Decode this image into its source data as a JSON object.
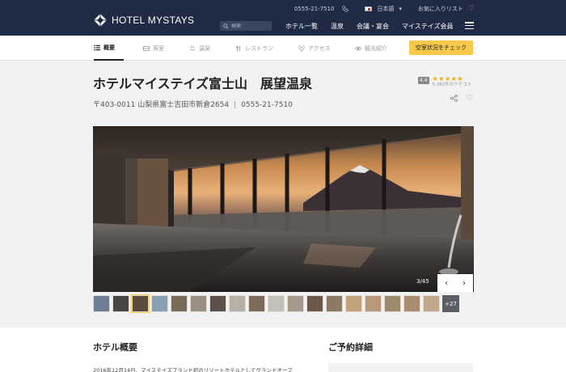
{
  "header": {
    "logo_text": "HOTEL MYSTAYS",
    "phone": "0555-21-7510",
    "language": "日本語",
    "favorites": "お気に入りリスト",
    "search_placeholder": "検索",
    "nav": [
      "ホテル一覧",
      "温泉",
      "会議・宴会",
      "マイステイズ会員"
    ]
  },
  "subnav": {
    "tabs": [
      {
        "label": "概要",
        "icon": "list-icon"
      },
      {
        "label": "客室",
        "icon": "bed-icon"
      },
      {
        "label": "温泉",
        "icon": "hot-spring-icon"
      },
      {
        "label": "レストラン",
        "icon": "restaurant-icon"
      },
      {
        "label": "アクセス",
        "icon": "map-pin-icon"
      },
      {
        "label": "観光紹介",
        "icon": "eye-icon"
      }
    ],
    "cta": "空室状況をチェック"
  },
  "hotel": {
    "title": "ホテルマイステイズ富士山　展望温泉",
    "postal_address": "〒403-0011 山梨県富士吉田市新倉2654",
    "phone": "0555-21-7510",
    "rating_score": "4.4",
    "stars": "★★★★★",
    "reviews": "5,382件のクチコミ"
  },
  "gallery": {
    "counter": "3/45",
    "prev": "‹",
    "next": "›",
    "more": "+27",
    "thumb_colors": [
      "#6f7f93",
      "#4a4540",
      "#5c4a3a",
      "#8aa0b0",
      "#7a6a5a",
      "#9a8f80",
      "#5d5048",
      "#b7b0a6",
      "#7d6b5a",
      "#c6c1b8",
      "#a59a8c",
      "#6b5a4c",
      "#8c7a66",
      "#c4a27a",
      "#b89a7a",
      "#9b8b6a",
      "#a88e6e",
      "#c2a88a"
    ]
  },
  "content": {
    "overview_heading": "ホテル概要",
    "overview_text": "2016年12月14日、マイステイズブランド初のリゾートホテルとしてグランドオープ",
    "booking_heading": "ご予約詳細"
  }
}
